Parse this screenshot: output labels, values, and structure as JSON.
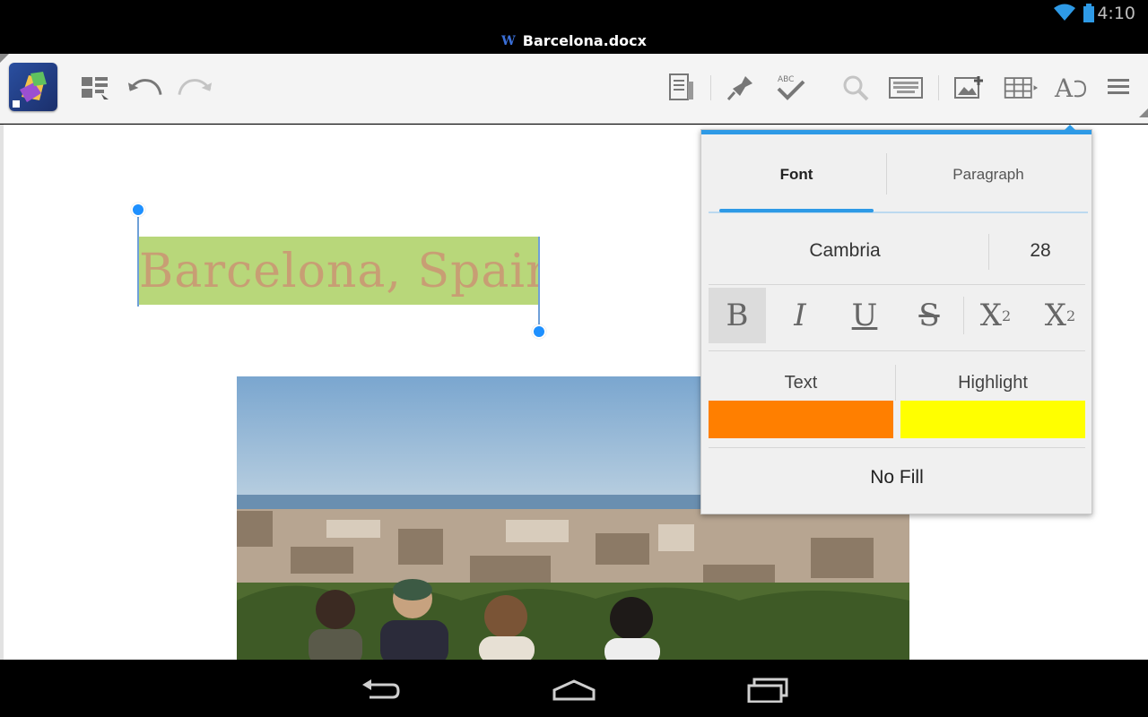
{
  "status_bar": {
    "time": "4:10"
  },
  "title_bar": {
    "file_name": "Barcelona.docx",
    "file_icon_letter": "W"
  },
  "toolbar": {
    "icons": [
      "app-logo-icon",
      "view-mode-icon",
      "undo-icon",
      "redo-icon",
      "page-layout-icon",
      "pin-icon",
      "spell-check-icon",
      "search-icon",
      "keyboard-icon",
      "insert-image-icon",
      "insert-table-icon",
      "text-format-icon",
      "menu-icon"
    ],
    "spell_label": "ABC"
  },
  "document": {
    "heading": "Barcelona, Spain",
    "heading_color": "#c89e74",
    "heading_highlight": "#b8d77a"
  },
  "format_panel": {
    "tabs": [
      {
        "label": "Font",
        "active": true
      },
      {
        "label": "Paragraph",
        "active": false
      }
    ],
    "font_name": "Cambria",
    "font_size": "28",
    "styles": {
      "bold": "B",
      "italic": "I",
      "underline": "U",
      "strike": "S",
      "superscript": "X",
      "superscript_mark": "2",
      "subscript": "X",
      "subscript_mark": "2"
    },
    "bold_active": true,
    "text_color_label": "Text",
    "highlight_label": "Highlight",
    "text_color": "#ff7f00",
    "highlight_color": "#ffff00",
    "no_fill_label": "No Fill",
    "accent_color": "#2e9ae6"
  },
  "nav_bar": {
    "buttons": [
      "back-icon",
      "home-icon",
      "recents-icon"
    ]
  }
}
